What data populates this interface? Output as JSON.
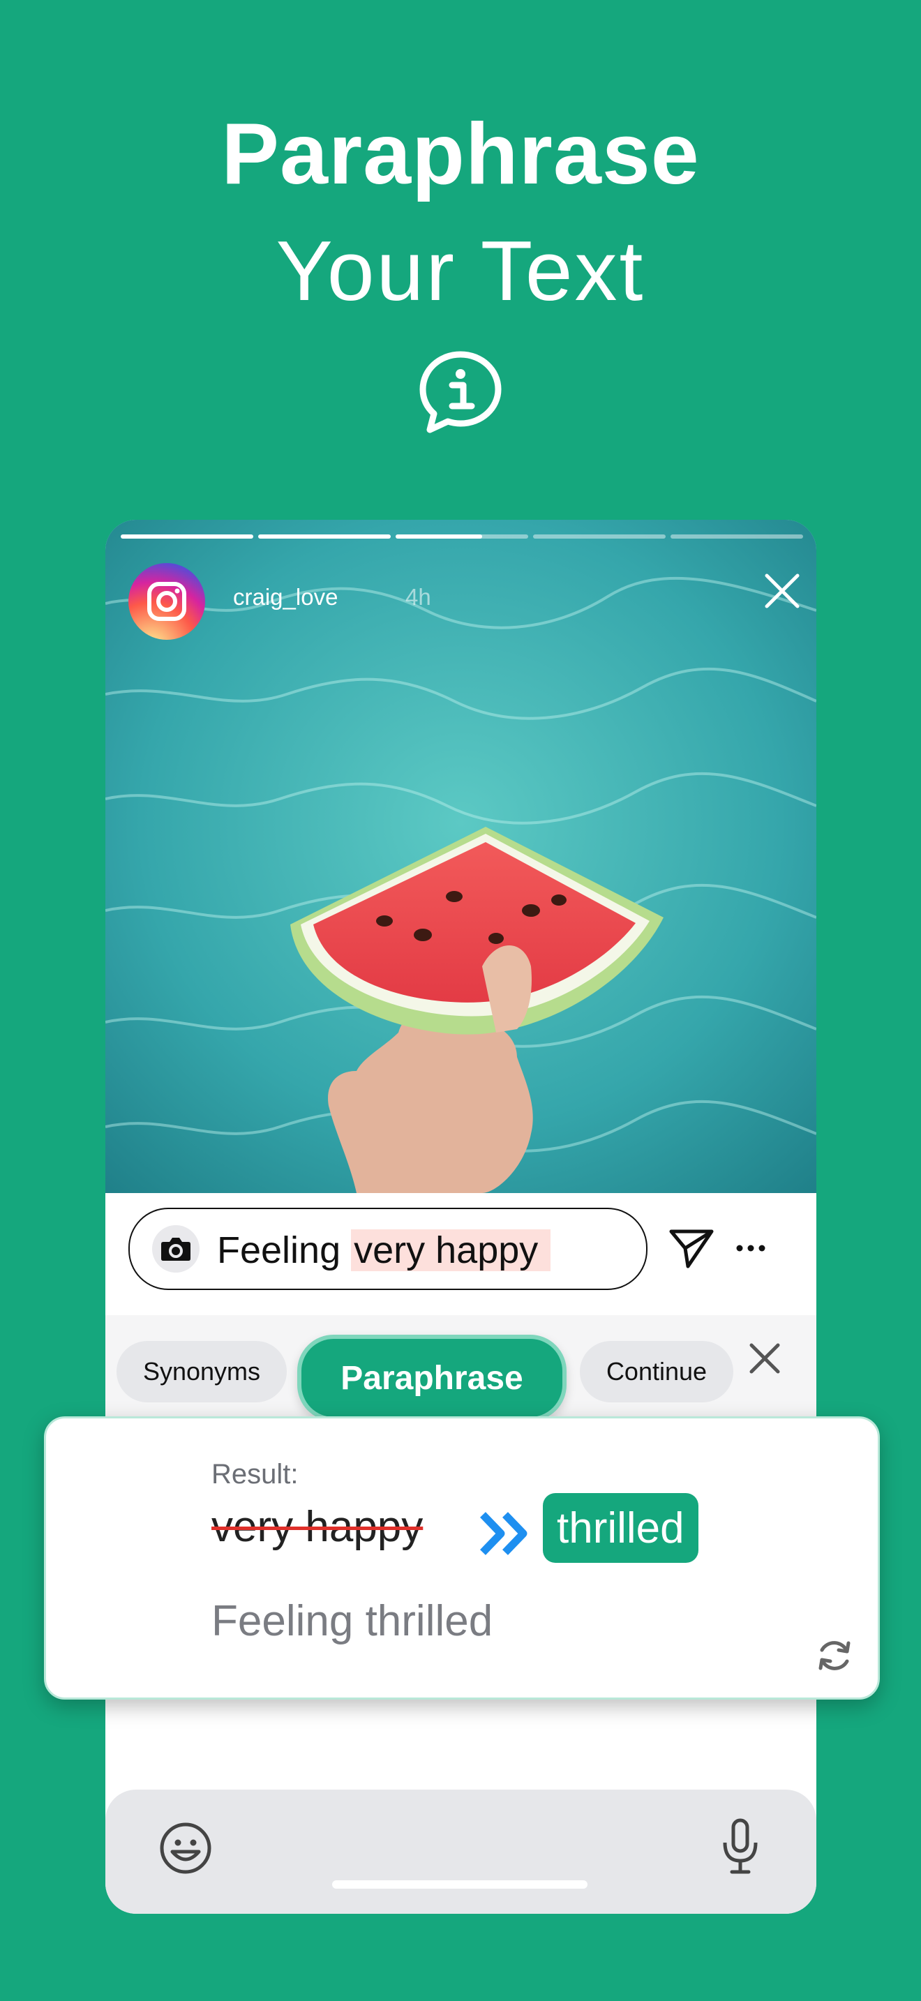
{
  "hero": {
    "title_bold": "Paraphrase",
    "title_light": "Your Text",
    "icon": "info-chat-bubble-icon"
  },
  "story": {
    "username": "craig_love",
    "time": "4h",
    "progress_segments": 5,
    "progress_active_index": 2,
    "progress_active_fraction": 0.65,
    "image": "watermelon-slice-over-pool-photo"
  },
  "reply": {
    "prefix": "Feeling ",
    "highlight": "very happy",
    "send_icon": "paper-plane-icon",
    "more_icon": "more-horizontal-icon"
  },
  "toolbar": {
    "synonyms_label": "Synonyms",
    "paraphrase_label": "Paraphrase",
    "continue_label": "Continue"
  },
  "result": {
    "label": "Result:",
    "original": "very happy",
    "replacement": "thrilled",
    "sentence": "Feeling thrilled"
  },
  "colors": {
    "brand": "#15a77d",
    "highlight": "#fde0dc",
    "strike": "#e0302a",
    "arrow": "#1e8ff0"
  }
}
